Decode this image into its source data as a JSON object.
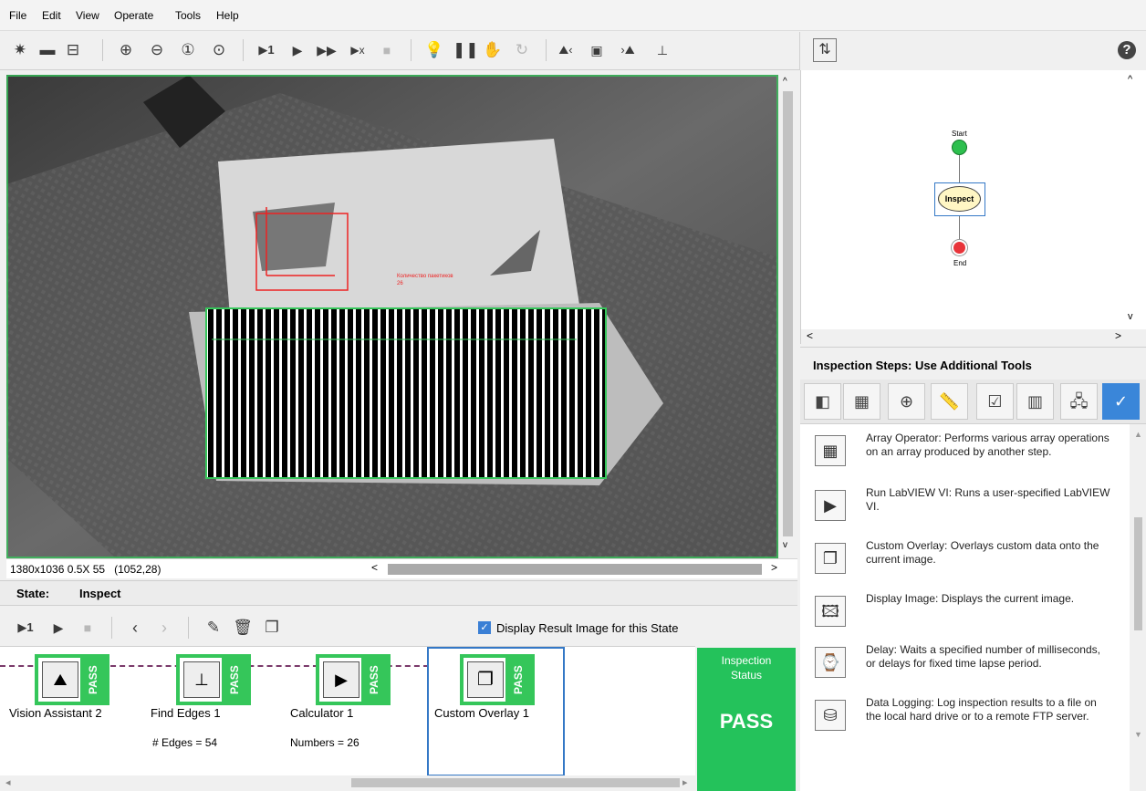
{
  "menu": [
    "File",
    "Edit",
    "View",
    "Operate",
    "Tools",
    "Help"
  ],
  "toolbar": {
    "icons": [
      "new-icon",
      "open-icon",
      "save-icon",
      "zoom-in-icon",
      "zoom-out-icon",
      "zoom-1to1-icon",
      "zoom-fit-icon",
      "run-once-icon",
      "run-icon",
      "run-continuous-icon",
      "run-stop-after-icon",
      "stop-icon",
      "light-icon",
      "pause-icon",
      "hand-icon",
      "reload-icon",
      "prev-image-icon",
      "image-icon",
      "next-image-icon",
      "chart-icon"
    ],
    "help": "?"
  },
  "image": {
    "overlay_text_line1": "Количество пакетиков",
    "overlay_text_line2": "26",
    "status": "1380x1036 0.5X 55",
    "coords": "(1052,28)"
  },
  "state": {
    "label": "State:",
    "name": "Inspect",
    "display_result_label": "Display Result Image for this State",
    "display_result_checked": true
  },
  "steps": [
    {
      "name": "Vision Assistant 2",
      "result": "",
      "status": "PASS"
    },
    {
      "name": "Find Edges 1",
      "result": "# Edges = 54",
      "status": "PASS"
    },
    {
      "name": "Calculator 1",
      "result": "Numbers = 26",
      "status": "PASS"
    },
    {
      "name": "Custom Overlay 1",
      "result": "",
      "status": "PASS"
    }
  ],
  "inspection_status": {
    "label_line1": "Inspection",
    "label_line2": "Status",
    "value": "PASS"
  },
  "flow": {
    "start": "Start",
    "inspect": "Inspect",
    "end": "End"
  },
  "inspection_steps_title": "Inspection Steps: Use Additional Tools",
  "tools": [
    {
      "icon": "array-operator-icon",
      "glyph": "▦",
      "desc": "Array Operator:  Performs various array operations on an array produced by another step."
    },
    {
      "icon": "labview-vi-icon",
      "glyph": "▶",
      "desc": "Run LabVIEW VI:  Runs a user-specified LabVIEW VI."
    },
    {
      "icon": "custom-overlay-icon",
      "glyph": "❐",
      "desc": "Custom Overlay:  Overlays custom data onto the current image."
    },
    {
      "icon": "display-image-icon",
      "glyph": "🖾",
      "desc": "Display Image:  Displays the current image."
    },
    {
      "icon": "delay-icon",
      "glyph": "⌚",
      "desc": "Delay:  Waits a specified number of milliseconds, or delays for fixed time lapse period."
    },
    {
      "icon": "data-logging-icon",
      "glyph": "⛁",
      "desc": "Data Logging:  Log inspection results to a file on the local hard drive or to a remote FTP server."
    }
  ]
}
